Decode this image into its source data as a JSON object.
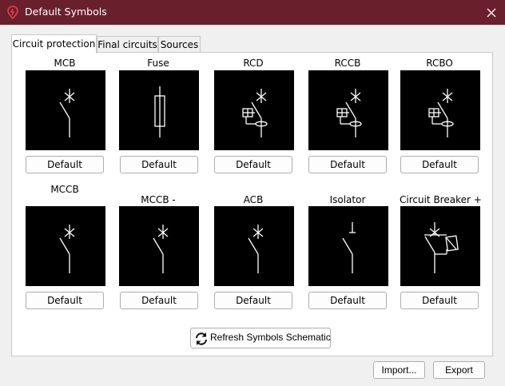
{
  "window": {
    "title": "Default Symbols",
    "close_icon": "close-icon"
  },
  "tabs": [
    {
      "label": "Circuit protection",
      "active": true
    },
    {
      "label": "Final circuits",
      "active": false
    },
    {
      "label": "Sources",
      "active": false
    }
  ],
  "symbols": [
    {
      "label": "MCB",
      "button": "Default",
      "icon": "mcb-symbol"
    },
    {
      "label": "Fuse",
      "button": "Default",
      "icon": "fuse-symbol"
    },
    {
      "label": "RCD",
      "button": "Default",
      "icon": "rcd-symbol"
    },
    {
      "label": "RCCB",
      "button": "Default",
      "icon": "rccb-symbol"
    },
    {
      "label": "RCBO",
      "button": "Default",
      "icon": "rcbo-symbol"
    },
    {
      "label": "MCCB",
      "button": "Default",
      "icon": "mccb-symbol"
    },
    {
      "label": "MCCB -",
      "button": "Default",
      "icon": "mccb-minus-symbol"
    },
    {
      "label": "ACB",
      "button": "Default",
      "icon": "acb-symbol"
    },
    {
      "label": "Isolator",
      "button": "Default",
      "icon": "isolator-symbol"
    },
    {
      "label": "Circuit Breaker +",
      "button": "Default",
      "icon": "circuit-breaker-plus-symbol"
    }
  ],
  "actions": {
    "refresh_label": "Refresh Symbols Schematic",
    "import_label": "Import...",
    "export_label": "Export"
  },
  "colors": {
    "titlebar": "#6a1f2c",
    "symbol_background": "#000000",
    "symbol_stroke": "#ffffff"
  }
}
